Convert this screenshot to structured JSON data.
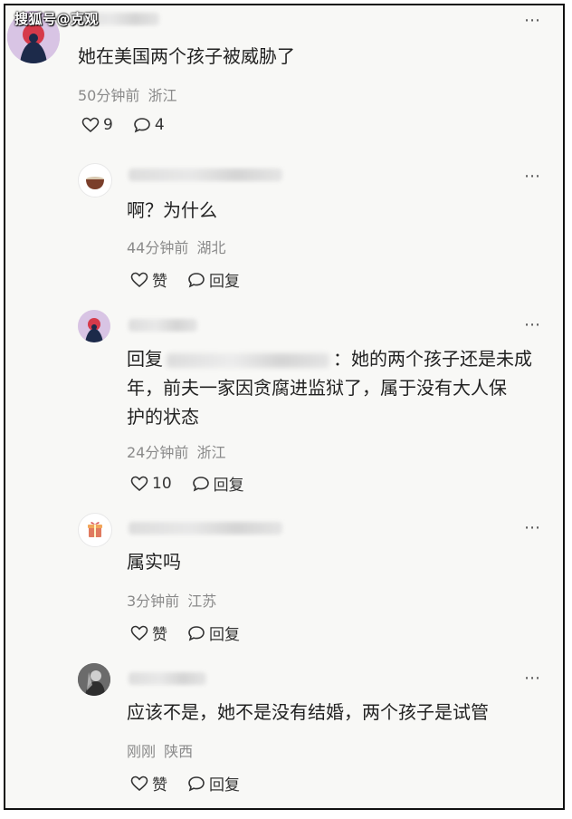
{
  "watermark": "搜狐号@克观",
  "comments": [
    {
      "text": "她在美国两个孩子被威胁了",
      "time": "50分钟前",
      "location": "浙江",
      "likes": "9",
      "replies": "4"
    },
    {
      "text": "啊？为什么",
      "time": "44分钟前",
      "location": "湖北",
      "like_label": "赞",
      "reply_label": "回复"
    },
    {
      "reply_prefix": "回复",
      "text_line1": "：她的两个孩子还是未成",
      "text_line2": "年，前夫一家因贪腐进监狱了，属于没有大人保",
      "text_line3": "护的状态",
      "time": "24分钟前",
      "location": "浙江",
      "likes": "10",
      "reply_label": "回复"
    },
    {
      "text": "属实吗",
      "time": "3分钟前",
      "location": "江苏",
      "like_label": "赞",
      "reply_label": "回复"
    },
    {
      "text": "应该不是，她不是没有结婚，两个孩子是试管",
      "time": "刚刚",
      "location": "陕西",
      "like_label": "赞",
      "reply_label": "回复"
    }
  ],
  "more_icon": "⋯"
}
